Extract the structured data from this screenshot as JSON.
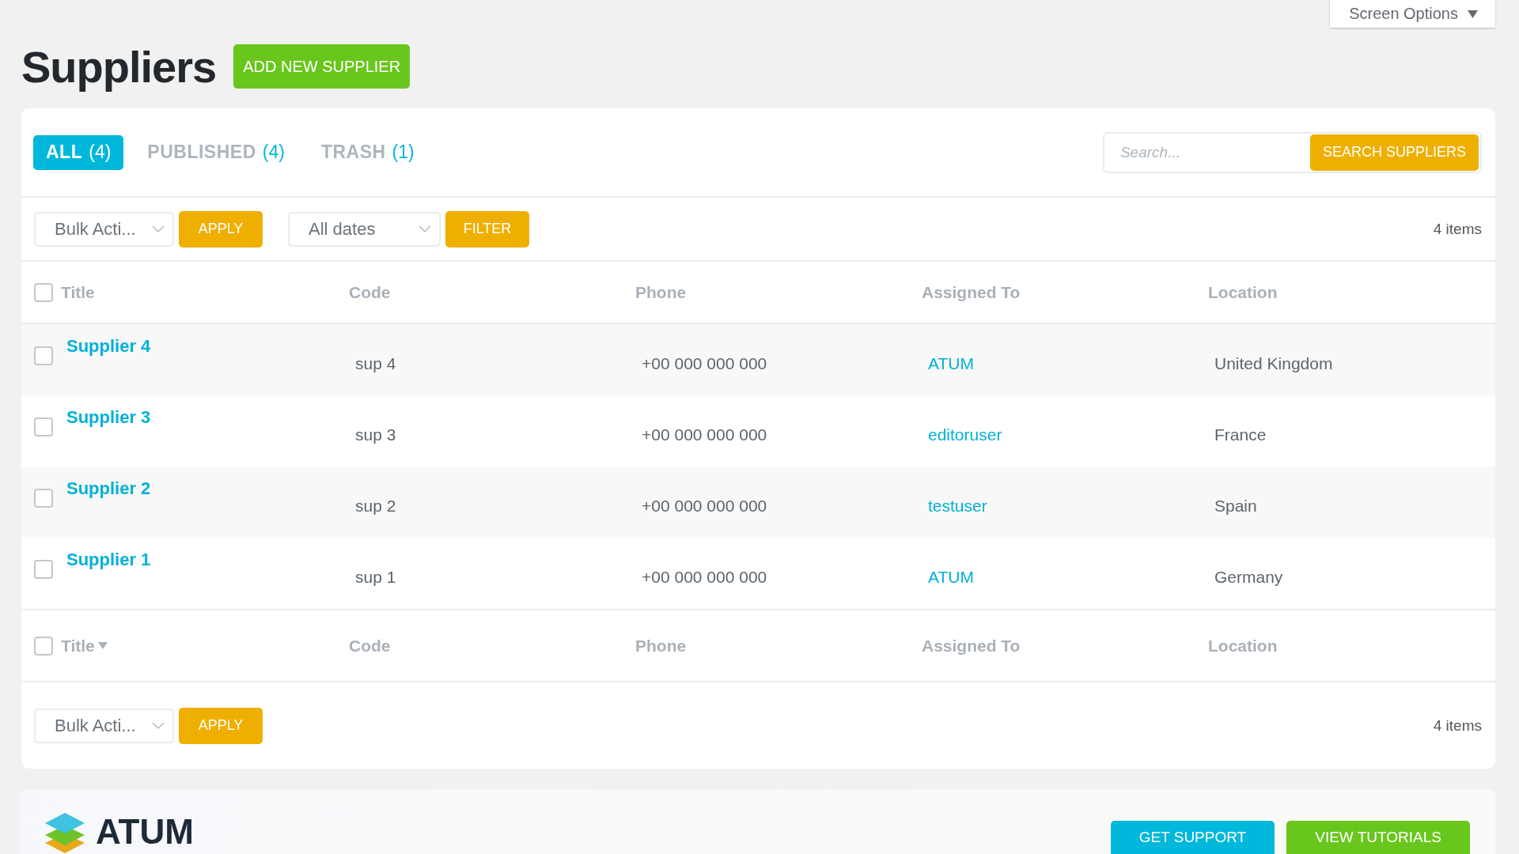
{
  "screen_options": {
    "label": "Screen Options"
  },
  "page_title": "Suppliers",
  "add_button": "ADD NEW SUPPLIER",
  "tabs": [
    {
      "label": "ALL",
      "count": "(4)",
      "selected": true
    },
    {
      "label": "PUBLISHED",
      "count": "(4)",
      "selected": false
    },
    {
      "label": "TRASH",
      "count": "(1)",
      "selected": false
    }
  ],
  "search": {
    "placeholder": "Search...",
    "button": "SEARCH SUPPLIERS"
  },
  "top_filters": {
    "bulk_action": "Bulk Acti...",
    "apply": "APPLY",
    "dates": "All dates",
    "filter": "FILTER",
    "item_count": "4 items"
  },
  "table": {
    "header_checked": false,
    "columns": [
      {
        "label": "Title",
        "sorted": false
      },
      {
        "label": "Code",
        "sorted": false
      },
      {
        "label": "Phone",
        "sorted": false
      },
      {
        "label": "Assigned To",
        "sorted": false
      },
      {
        "label": "Location",
        "sorted": false
      }
    ],
    "rows": [
      {
        "checked": false,
        "title": "Supplier 4",
        "code": "sup 4",
        "phone": "+00 000 000 000",
        "assigned_to": "ATUM",
        "location": "United Kingdom"
      },
      {
        "checked": false,
        "title": "Supplier 3",
        "code": "sup 3",
        "phone": "+00 000 000 000",
        "assigned_to": "editoruser",
        "location": "France"
      },
      {
        "checked": false,
        "title": "Supplier 2",
        "code": "sup 2",
        "phone": "+00 000 000 000",
        "assigned_to": "testuser",
        "location": "Spain"
      },
      {
        "checked": false,
        "title": "Supplier 1",
        "code": "sup 1",
        "phone": "+00 000 000 000",
        "assigned_to": "ATUM",
        "location": "Germany"
      }
    ],
    "footer_checked": false,
    "footer_columns": [
      {
        "label": "Title",
        "sorted": true
      },
      {
        "label": "Code",
        "sorted": false
      },
      {
        "label": "Phone",
        "sorted": false
      },
      {
        "label": "Assigned To",
        "sorted": false
      },
      {
        "label": "Location",
        "sorted": false
      }
    ]
  },
  "bottom_filters": {
    "bulk_action": "Bulk Acti...",
    "apply": "APPLY",
    "item_count": "4 items"
  },
  "footer": {
    "logo_text": "ATUM",
    "buttons": [
      {
        "label": "GET SUPPORT",
        "kind": "support"
      },
      {
        "label": "VIEW TUTORIALS",
        "kind": "tutorials"
      }
    ]
  }
}
